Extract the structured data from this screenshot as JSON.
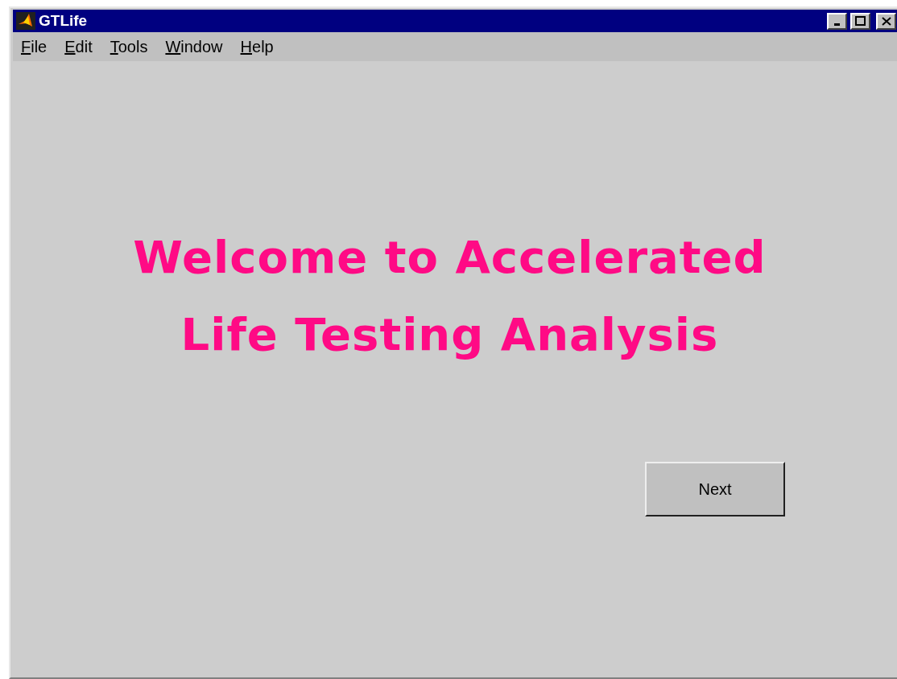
{
  "window": {
    "title": "GTLife"
  },
  "menu": [
    "File",
    "Edit",
    "Tools",
    "Window",
    "Help"
  ],
  "welcome": {
    "lines": [
      "Welcome to Accelerated",
      "Life Testing Analysis"
    ]
  },
  "buttons": [
    "Next"
  ]
}
